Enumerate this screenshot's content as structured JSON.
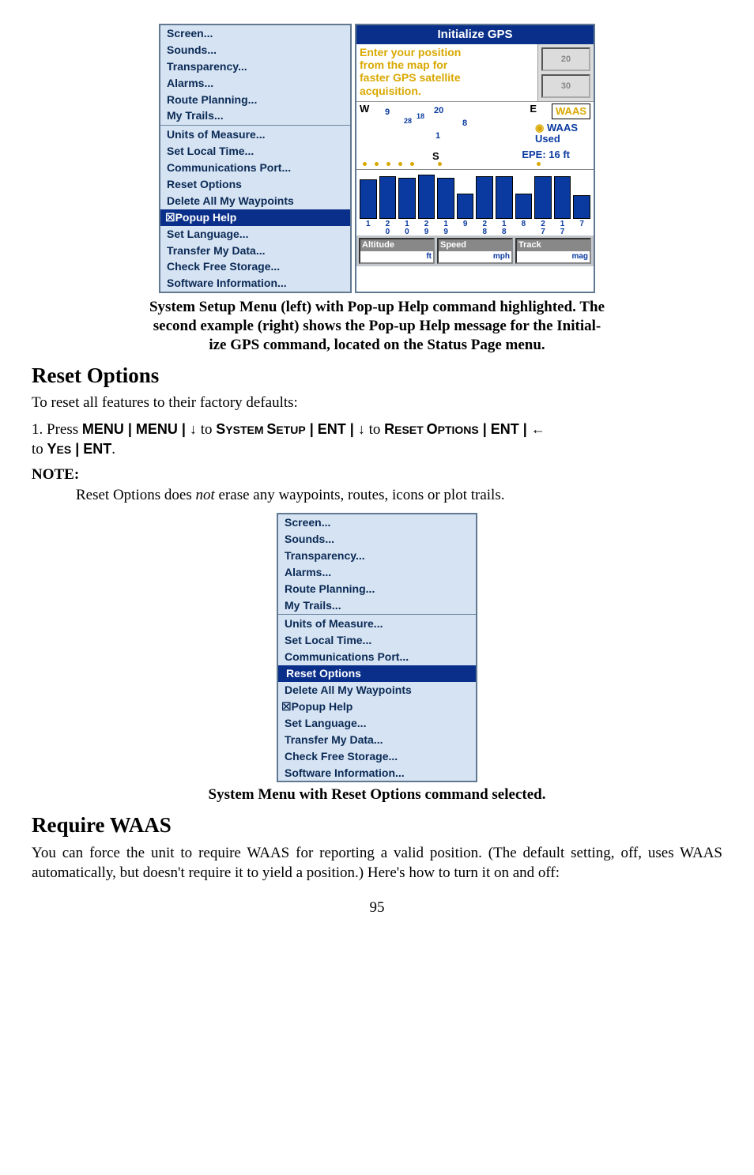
{
  "fig1": {
    "menu": {
      "group1": [
        "Screen...",
        "Sounds...",
        "Transparency...",
        "Alarms...",
        "Route Planning...",
        "My Trails..."
      ],
      "group2": [
        "Units of Measure...",
        "Set Local Time...",
        "Communications Port...",
        "Reset Options",
        "Delete All My Waypoints"
      ],
      "highlight_prefix": "☒",
      "highlight_label": "Popup Help",
      "group3": [
        "Set Language...",
        "Transfer My Data...",
        "Check Free Storage...",
        "Software Information..."
      ]
    },
    "gps": {
      "title": "Initialize GPS",
      "help_lines": [
        "Enter your position",
        "from the map for",
        "faster GPS satellite",
        "acquisition."
      ],
      "gauge1": "20",
      "gauge2": "30",
      "dir_w": "W",
      "dir_e": "E",
      "dir_s": "S",
      "waas_box": "WAAS",
      "waas_used_l1": "WAAS",
      "waas_used_l2": "Used",
      "epe": "EPE: 16 ft",
      "sat_nums": {
        "n9": "9",
        "n28": "28",
        "n18": "18",
        "n20": "20",
        "n8": "8",
        "n1": "1"
      },
      "sat_labels": [
        {
          "t": "1",
          "b": ""
        },
        {
          "t": "2",
          "b": "0"
        },
        {
          "t": "1",
          "b": "0"
        },
        {
          "t": "2",
          "b": "9"
        },
        {
          "t": "1",
          "b": "9"
        },
        {
          "t": "9",
          "b": ""
        },
        {
          "t": "2",
          "b": "8"
        },
        {
          "t": "1",
          "b": "8"
        },
        {
          "t": "8",
          "b": ""
        },
        {
          "t": "2",
          "b": "7"
        },
        {
          "t": "1",
          "b": "7"
        },
        {
          "t": "7",
          "b": ""
        }
      ],
      "fields": {
        "alt_hdr": "Altitude",
        "alt_unit": "ft",
        "spd_hdr": "Speed",
        "spd_unit": "mph",
        "trk_hdr": "Track",
        "trk_unit": "mag"
      }
    }
  },
  "caption1": {
    "l1": "System Setup Menu (left) with Pop-up Help command highlighted. The",
    "l2": "second example (right) shows the Pop-up Help message for the Initial-",
    "l3": "ize GPS command, located on the Status Page menu."
  },
  "section1": {
    "heading": "Reset Options",
    "intro": "To reset all features to their factory defaults:",
    "instr": {
      "p1": "1. Press ",
      "menu": "MENU",
      "bar": " | ",
      "arr_dn": "↓",
      "to": " to ",
      "sys": "S",
      "ys": "YSTEM ",
      "setup1": "S",
      "etup": "ETUP",
      "ent": "ENT",
      "reset1": "R",
      "eset": "ESET ",
      "opt1": "O",
      "pts": "PTIONS",
      "arr_lf": "←",
      "yes1": "Y",
      "es": "ES",
      "dot": "."
    },
    "note_hdr": "NOTE:",
    "note_p1": "Reset Options does ",
    "note_em": "not",
    "note_p2": " erase any waypoints, routes, icons or plot trails."
  },
  "fig2": {
    "group1": [
      "Screen...",
      "Sounds...",
      "Transparency...",
      "Alarms...",
      "Route Planning...",
      "My Trails..."
    ],
    "group2": [
      "Units of Measure...",
      "Set Local Time...",
      "Communications Port..."
    ],
    "highlight": "Reset Options",
    "after_hl": "Delete All My Waypoints",
    "check_prefix": "☒",
    "check_label": "Popup Help",
    "group3": [
      "Set Language...",
      "Transfer My Data...",
      "Check Free Storage...",
      "Software Information..."
    ]
  },
  "caption2": "System Menu with Reset Options command selected.",
  "section2": {
    "heading": "Require WAAS",
    "p": "You can force the unit to require WAAS for reporting a valid position. (The default setting, off, uses WAAS automatically, but doesn't require it to yield a position.) Here's how to turn it on and off:"
  },
  "page": "95"
}
